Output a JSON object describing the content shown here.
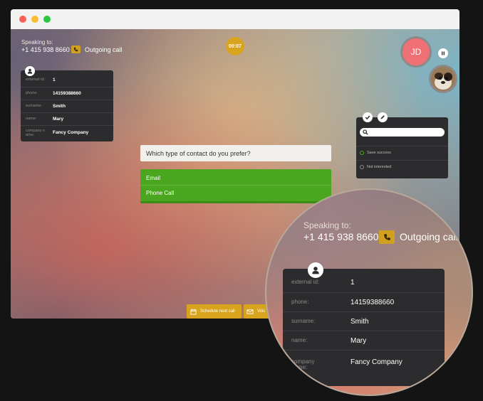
{
  "call": {
    "speaking_to_label": "Speaking to:",
    "phone_number": "+1 415 938 8660",
    "status": "Outgoing call",
    "timer": "00:07"
  },
  "avatar": {
    "initials": "JD"
  },
  "contact_info": {
    "rows": [
      {
        "label": "external id:",
        "value": "1"
      },
      {
        "label": "phone:",
        "value": "14159388660"
      },
      {
        "label": "surname:",
        "value": "Smith"
      },
      {
        "label": "name:",
        "value": "Mary"
      },
      {
        "label": "company n ame:",
        "value": "Fancy Company"
      }
    ]
  },
  "magnified_contact_info": {
    "rows": [
      {
        "label": "external id:",
        "value": "1"
      },
      {
        "label": "phone:",
        "value": "14159388660"
      },
      {
        "label": "surname:",
        "value": "Smith"
      },
      {
        "label": "name:",
        "value": "Mary"
      },
      {
        "label": "company name:",
        "value": "Fancy Company"
      }
    ]
  },
  "script": {
    "question": "Which type of contact do you prefer?",
    "answers": [
      "Email",
      "Phone Call"
    ]
  },
  "outcomes": {
    "search_placeholder": "",
    "items": [
      "Save success",
      "Not interested"
    ]
  },
  "bottom_buttons": {
    "schedule": "Schedule next call",
    "voicemail": "Voic"
  },
  "colors": {
    "accent_gold": "#d9a41d",
    "answer_green": "#4aa51f",
    "panel_dark": "#2c2c2e",
    "avatar_pink": "#ee6f74"
  },
  "icons": [
    "phone-icon",
    "user-icon",
    "pause-icon",
    "check-icon",
    "pencil-icon",
    "search-icon",
    "calendar-icon",
    "voicemail-icon"
  ]
}
